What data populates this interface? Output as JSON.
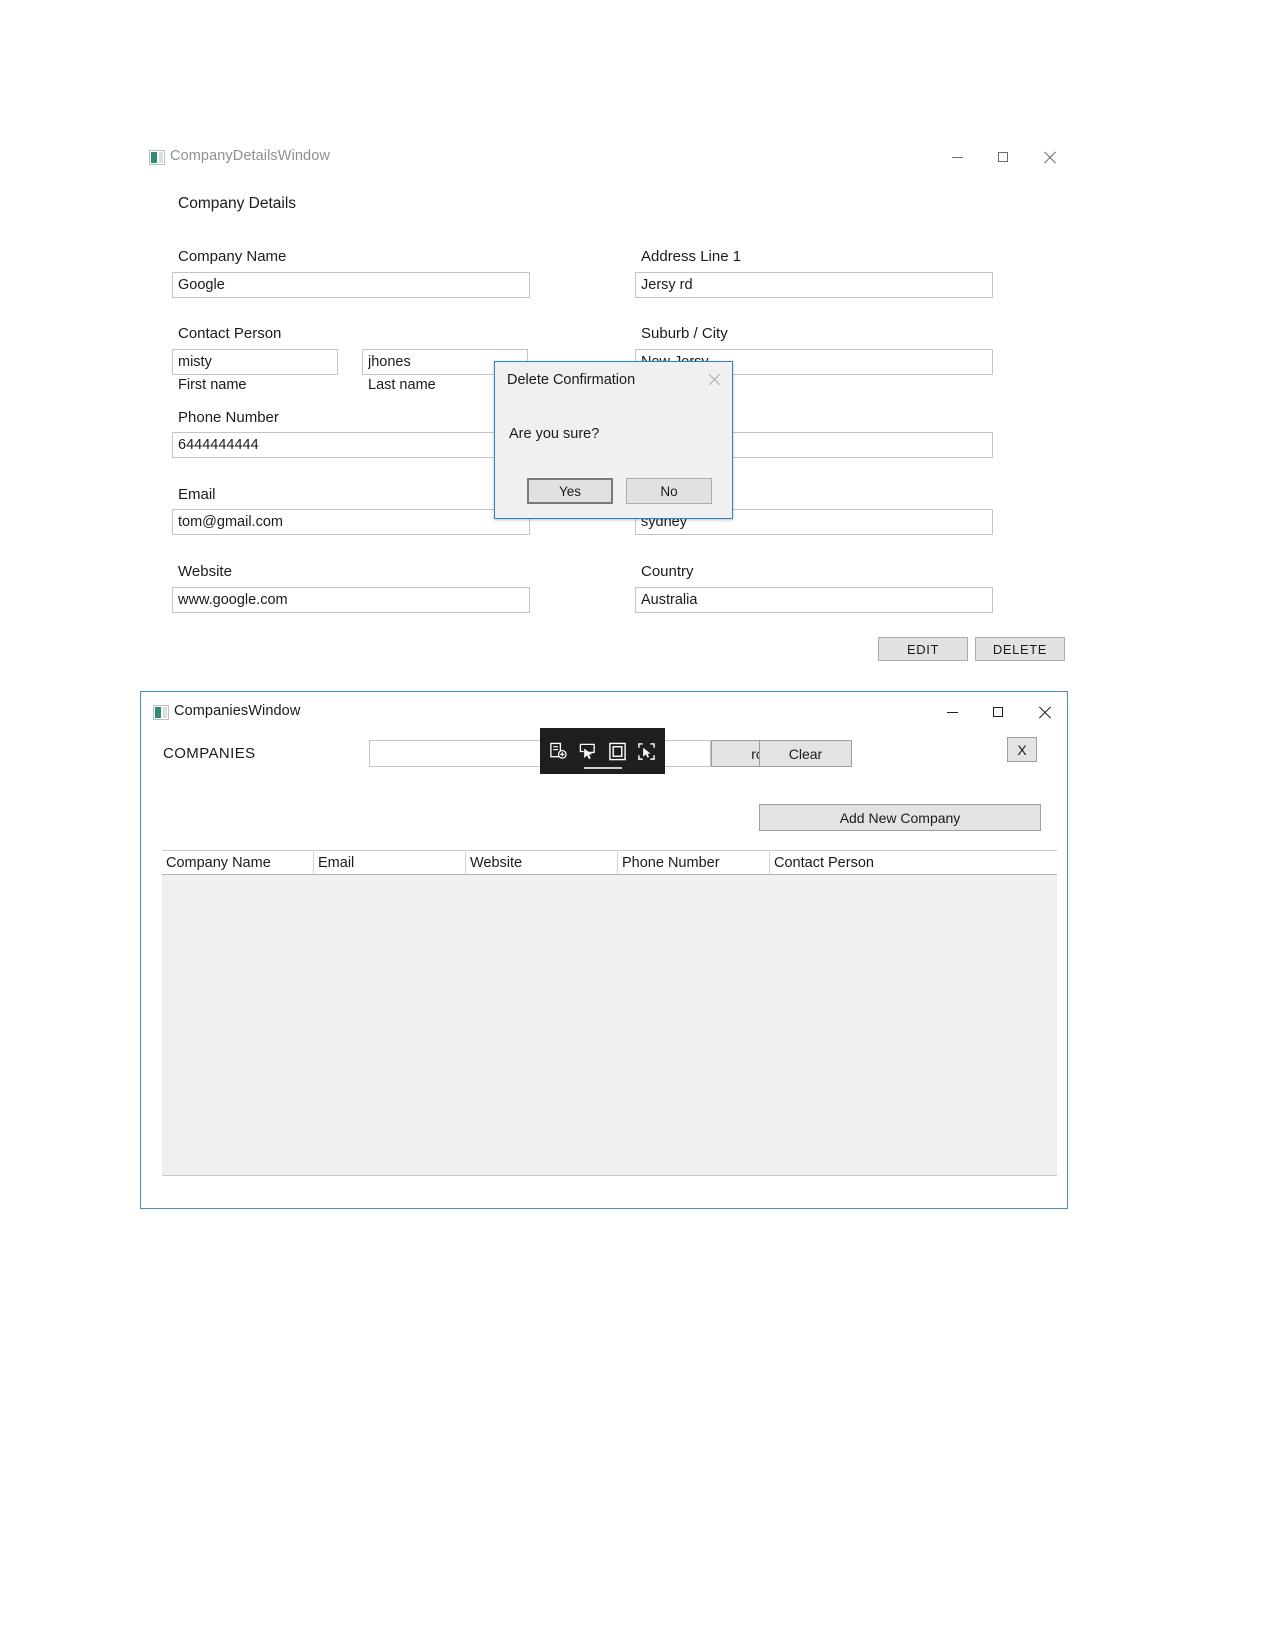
{
  "details_window": {
    "title": "CompanyDetailsWindow",
    "icon": "app-icon",
    "controls": {
      "minimize": "minimize-icon",
      "maximize": "maximize-icon",
      "close": "close-icon"
    },
    "heading": "Company Details",
    "fields": {
      "company_name": {
        "label": "Company Name",
        "value": "Google"
      },
      "address_line_1": {
        "label": "Address Line 1",
        "value": "Jersy rd"
      },
      "contact_person": {
        "label": "Contact Person"
      },
      "first_name": {
        "value": "misty",
        "sublabel": "First name"
      },
      "last_name": {
        "value": "jhones",
        "sublabel": "Last name"
      },
      "suburb_city": {
        "label": "Suburb / City",
        "value": "New Jersy"
      },
      "phone_number": {
        "label": "Phone Number",
        "value": "6444444444"
      },
      "state": {
        "value": ""
      },
      "email": {
        "label": "Email",
        "value": "tom@gmail.com"
      },
      "city2": {
        "value": "sydney"
      },
      "website": {
        "label": "Website",
        "value": "www.google.com"
      },
      "country": {
        "label": "Country",
        "value": "Australia"
      }
    },
    "buttons": {
      "edit": "EDIT",
      "delete": "DELETE"
    }
  },
  "delete_dialog": {
    "title": "Delete Confirmation",
    "close": "close-icon",
    "message": "Are you sure?",
    "yes": "Yes",
    "no": "No"
  },
  "companies_window": {
    "title": "CompaniesWindow",
    "icon": "app-icon",
    "controls": {
      "minimize": "minimize-icon",
      "maximize": "maximize-icon",
      "close": "close-icon"
    },
    "section_label": "COMPANIES",
    "search_value": "",
    "search_button": "rch",
    "clear_button": "Clear",
    "x_button": "X",
    "add_button": "Add New Company",
    "grid": {
      "columns": [
        "Company Name",
        "Email",
        "Website",
        "Phone Number",
        "Contact Person"
      ],
      "rows": []
    }
  },
  "snip_toolbar": {
    "buttons": [
      {
        "name": "new-snip-icon"
      },
      {
        "name": "freeform-snip-icon"
      },
      {
        "name": "window-snip-icon"
      },
      {
        "name": "fullscreen-snip-icon"
      }
    ]
  }
}
